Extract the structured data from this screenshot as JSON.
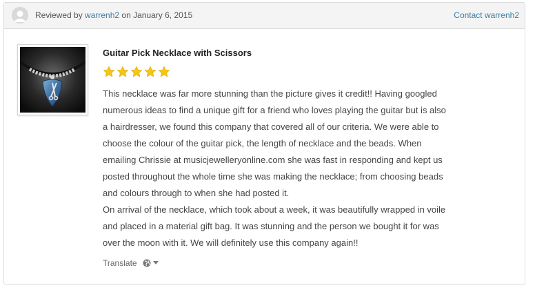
{
  "header": {
    "reviewed_prefix": "Reviewed by",
    "reviewer": "warrenh2",
    "date_text": "on January 6, 2015",
    "contact_label": "Contact warrenh2"
  },
  "product": {
    "title": "Guitar Pick Necklace with Scissors",
    "image_icon": "necklace-photo"
  },
  "rating": {
    "value": 5,
    "max": 5,
    "star_color": "#f5c518"
  },
  "review": {
    "lines": [
      "This necklace was far more stunning than the picture gives it credit!! Having googled",
      "numerous ideas to find a unique gift for a friend who loves playing the guitar but is also",
      "a hairdresser, we found this company that covered all of our criteria. We were able to",
      "choose the colour of the guitar pick, the length of necklace and the beads. When",
      "emailing Chrissie at musicjewelleryonline.com she was fast in responding and kept us",
      "posted throughout the whole time she was making the necklace; from choosing beads",
      "and colours through to when she had posted it.",
      "On arrival of the necklace, which took about a week, it was beautifully wrapped in voile",
      "and placed in a material gift bag. It was stunning and the person we bought it for was",
      "over the moon with it. We will definitely use this company again!!"
    ]
  },
  "translate": {
    "label": "Translate",
    "icon": "globe-icon"
  },
  "colors": {
    "link": "#3d7ea6",
    "header_bg": "#f4f4f4"
  }
}
